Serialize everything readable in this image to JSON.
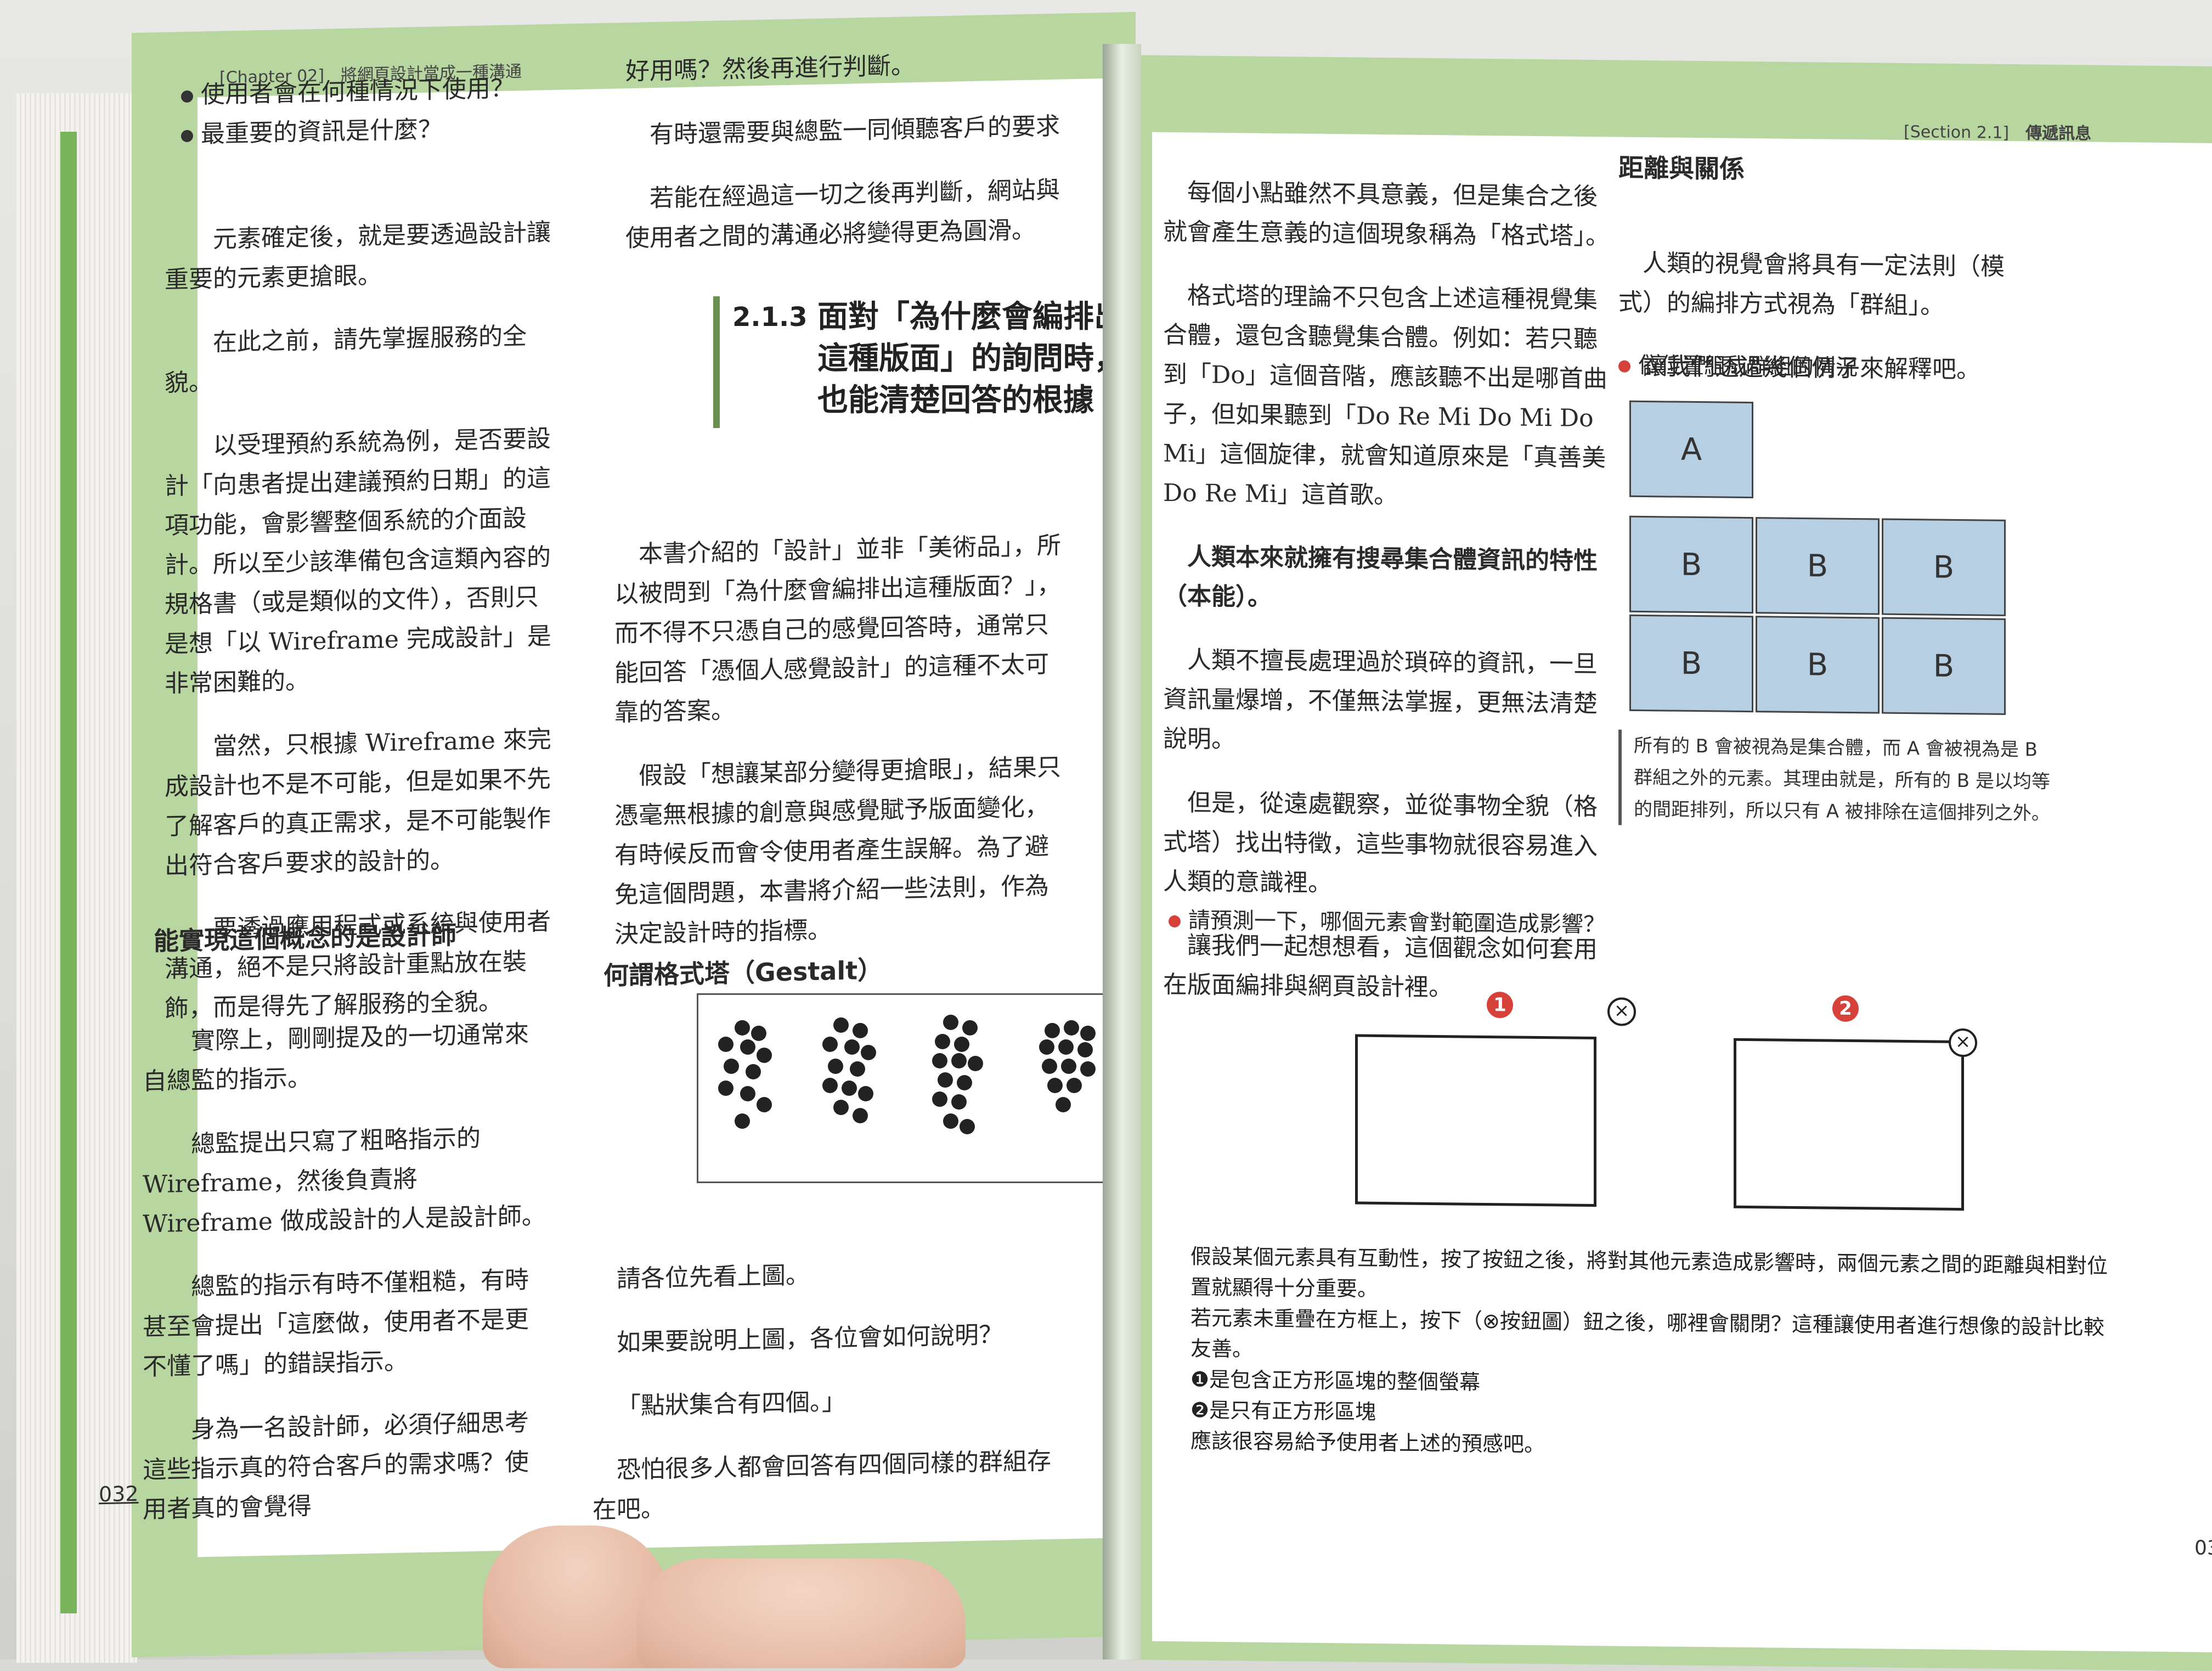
{
  "left_page": {
    "running_head": "[Chapter 02]　將網頁設計當成一種溝通",
    "bullets": [
      "使用者會在何種情況下使用？",
      "最重要的資訊是什麼？"
    ],
    "col1_paragraphs": [
      "元素確定後，就是要透過設計讓重要的元素更搶眼。",
      "在此之前，請先掌握服務的全貌。",
      "以受理預約系統為例，是否要設計「向患者提出建議預約日期」的這項功能，會影響整個系統的介面設計。所以至少該準備包含這類內容的規格書（或是類似的文件），否則只是想「以 Wireframe 完成設計」是非常困難的。",
      "當然，只根據 Wireframe 來完成設計也不是不可能，但是如果不先了解客戶的真正需求，是不可能製作出符合客戶要求的設計的。",
      "要透過應用程式或系統與使用者溝通，絕不是只將設計重點放在裝飾，而是得先了解服務的全貌。"
    ],
    "subheading1": "能實現這個概念的是設計師",
    "col1_paragraphs_b": [
      "實際上，剛剛提及的一切通常來自總監的指示。",
      "總監提出只寫了粗略指示的 Wireframe，然後負責將 Wireframe 做成設計的人是設計師。",
      "總監的指示有時不僅粗糙，有時甚至會提出「這麼做，使用者不是更不懂了嗎」的錯誤指示。",
      "身為一名設計師，必須仔細思考這些指示真的符合客戶的需求嗎？使用者真的會覺得"
    ],
    "col2_top": [
      "好用嗎？然後再進行判斷。",
      "有時還需要與總監一同傾聽客戶的要求",
      "若能在經過這一切之後再判斷，網站與使用者之間的溝通必將變得更為圓滑。"
    ],
    "section_number": "2.1.3",
    "section_title": "面對「為什麼會編排出這種版面」的詢問時，也能清楚回答的根據",
    "col2_paragraphs": [
      "本書介紹的「設計」並非「美術品」，所以被問到「為什麼會編排出這種版面？」，而不得不只憑自己的感覺回答時，通常只能回答「憑個人感覺設計」的這種不太可靠的答案。",
      "假設「想讓某部分變得更搶眼」，結果只憑毫無根據的創意與感覺賦予版面變化，有時候反而會令使用者產生誤解。為了避免這個問題，本書將介紹一些法則，作為決定設計時的指標。"
    ],
    "subheading2": "何謂格式塔（Gestalt）",
    "col2_after_fig": [
      "請各位先看上圖。",
      "如果要說明上圖，各位會如何說明？",
      "「點狀集合有四個。」",
      "恐怕很多人都會回答有四個同樣的群組存在吧。"
    ],
    "page_number": "032"
  },
  "right_page": {
    "running_head_section": "[Section 2.1]",
    "running_head_title": "傳遞訊息",
    "col1_paragraphs": [
      "每個小點雖然不具意義，但是集合之後就會產生意義的這個現象稱為「格式塔」。",
      "格式塔的理論不只包含上述這種視覺集合體，還包含聽覺集合體。例如：若只聽到「Do」這個音階，應該聽不出是哪首曲子，但如果聽到「Do Re Mi Do Mi Do Mi」這個旋律，就會知道原來是「真善美 Do Re Mi」這首歌。",
      "人類本來就擁有搜尋集合體資訊的特性（本能）。",
      "人類不擅長處理過於瑣碎的資訊，一旦資訊量爆增，不僅無法掌握，更無法清楚說明。",
      "但是，從遠處觀察，並從事物全貌（格式塔）找出特徵，這些事物就很容易進入人類的意識裡。",
      "讓我們一起想想看，這個觀念如何套用在版面編排與網頁設計裡。"
    ],
    "subheading": "距離與關係",
    "col2_paragraphs": [
      "人類的視覺會將具有一定法則（模式）的編排方式視為「群組」。",
      "讓我們透過幾個例子來解釋吧。"
    ],
    "fig1_caption_bullet": "依位置組成群組的情況",
    "block_a": "A",
    "block_b": "B",
    "fig1_note": "所有的 B 會被視為是集合體，而 A 會被視為是 B 群組之外的元素。其理由就是，所有的 B 是以均等的間距排列，所以只有 A 被排除在這個排列之外。",
    "fig2_caption_bullet": "請預測一下，哪個元素會對範圍造成影響？",
    "marker1": "1",
    "marker2": "2",
    "close_symbol": "×",
    "bottom_lines": [
      "假設某個元素具有互動性，按了按鈕之後，將對其他元素造成影響時，兩個元素之間的距離與相對位置就顯得十分重要。",
      "若元素未重疊在方框上，按下（⊗按鈕圖）鈕之後，哪裡會關閉？這種讓使用者進行想像的設計比較友善。",
      "❶是包含正方形區塊的整個螢幕",
      "❷是只有正方形區塊",
      "應該很容易給予使用者上述的預感吧。"
    ],
    "page_number_partial": "03"
  }
}
